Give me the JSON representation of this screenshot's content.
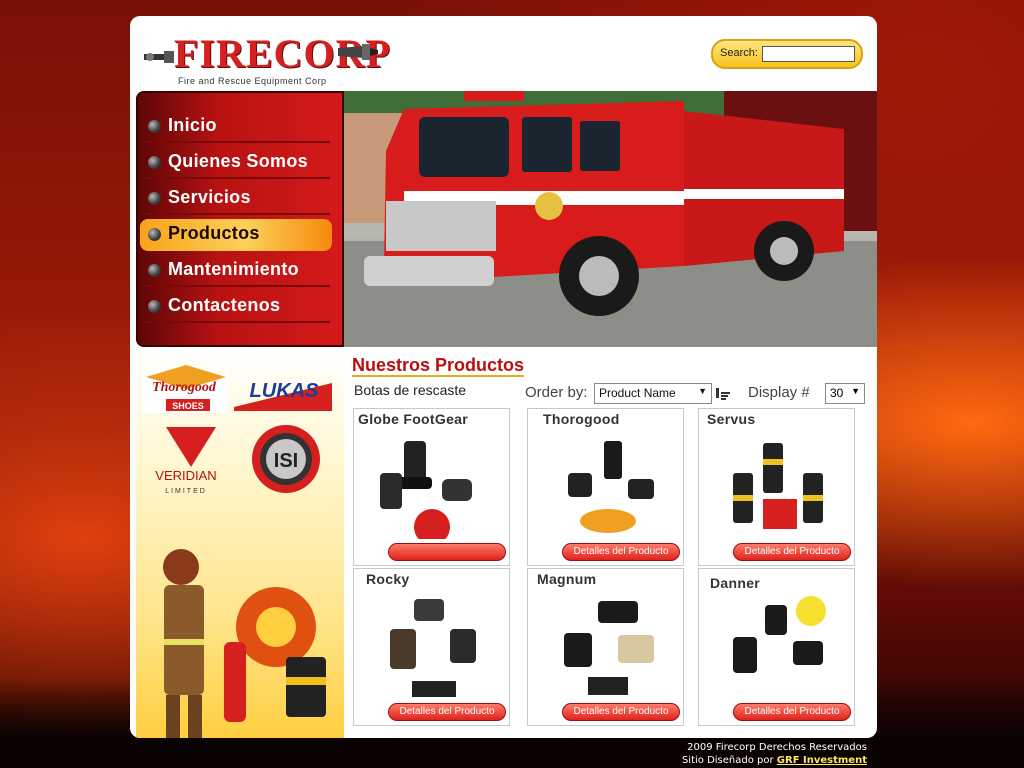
{
  "logo": {
    "name": "FIRECORP",
    "tagline": "Fire and Rescue Equipment Corp"
  },
  "search": {
    "label": "Search:",
    "value": "",
    "placeholder": ""
  },
  "nav": {
    "items": [
      {
        "label": "Inicio"
      },
      {
        "label": "Quienes Somos"
      },
      {
        "label": "Servicios"
      },
      {
        "label": "Productos",
        "active": true
      },
      {
        "label": "Mantenimiento"
      },
      {
        "label": "Contactenos"
      }
    ]
  },
  "sidebar": {
    "brands": [
      "Thorogood Shoes",
      "LUKAS",
      "VERIDIAN LIMITED",
      "ISI"
    ],
    "lukas_text": "LUKAS",
    "veridian_text": "VERIDIAN",
    "veridian_sub": "LIMITED",
    "thorogood_text": "Thorogood",
    "thorogood_sub": "SHOES",
    "isi_text": "ISI"
  },
  "content": {
    "title": "Nuestros Productos",
    "category": "Botas de rescaste",
    "order_by_label": "Order by:",
    "order_by_value": "Product Name",
    "display_label": "Display #",
    "display_value": "30"
  },
  "products": [
    {
      "name": "Globe FootGear",
      "button": ""
    },
    {
      "name": "Thorogood",
      "button": "Detalles del Producto"
    },
    {
      "name": "Servus",
      "button": "Detalles del Producto"
    },
    {
      "name": "Rocky",
      "button": "Detalles del Producto"
    },
    {
      "name": "Magnum",
      "button": "Detalles del Producto"
    },
    {
      "name": "Danner",
      "button": "Detalles del Producto"
    }
  ],
  "footer": {
    "copyright": "2009 Firecorp Derechos Reservados",
    "designed_by": "Sitio Diseñado por",
    "designer_link": "GRF Investment"
  },
  "colors": {
    "brand_red": "#d61f1f",
    "nav_red": "#b91212",
    "active_orange": "#f9a21a",
    "search_yellow": "#f7c21c"
  }
}
